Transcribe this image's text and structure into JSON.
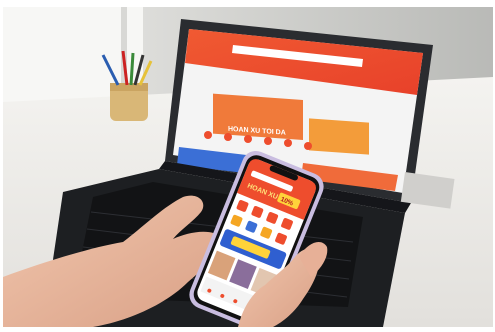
{
  "photo": {
    "phone_banner_text": "HOAN XU",
    "phone_banner_badge": "10%",
    "laptop_banner_text": "HOAN XU TOI DA"
  },
  "colors": {
    "brand_orange": "#ee4d2d",
    "desk": "#eceae6",
    "wall": "#cfd0cd",
    "laptop_body": "#1f2124",
    "skin": "#e9b9a0"
  }
}
